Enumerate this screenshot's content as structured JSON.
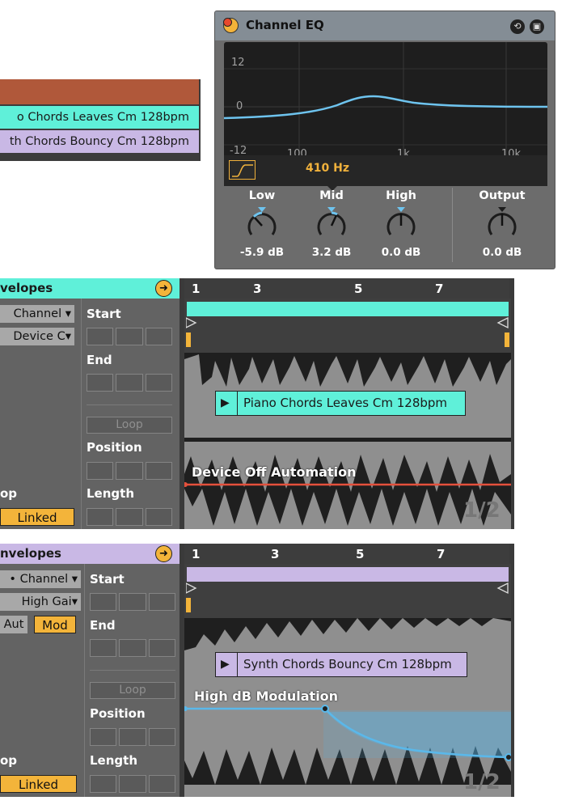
{
  "clip_list": {
    "items": [
      {
        "label": "o Chords Leaves Cm 128bpm",
        "color": "#5ff0d9"
      },
      {
        "label": "th Chords Bouncy Cm 128bpm",
        "color": "#c9b8e5"
      }
    ]
  },
  "eq_device": {
    "title": "Channel EQ",
    "db_ticks": [
      "12",
      "0",
      "-12"
    ],
    "freq_ticks": [
      "100",
      "1k",
      "10k"
    ],
    "frequency": "410 Hz",
    "knobs": [
      {
        "label": "Low",
        "value": "-5.9 dB"
      },
      {
        "label": "Mid",
        "value": "3.2 dB"
      },
      {
        "label": "High",
        "value": "0.0 dB"
      },
      {
        "label": "Output",
        "value": "0.0 dB"
      }
    ],
    "icons": [
      "fold-icon",
      "hot-swap-icon",
      "save-preset-icon",
      "filter-shape-icon"
    ]
  },
  "panels": [
    {
      "title": "velopes",
      "color": "#5ff0d9",
      "dropdown1": "Channel ▾",
      "dropdown2": "Device C▾",
      "start_label": "Start",
      "end_label": "End",
      "loop_button": "Loop",
      "position_label": "Position",
      "length_label": "Length",
      "loop_word": "op",
      "linked": "Linked",
      "ruler": [
        "1",
        "3",
        "5",
        "7"
      ],
      "clip_name": "Piano Chords Leaves Cm 128bpm",
      "automation_label": "Device Off Automation",
      "page": "1/2",
      "automation_color": "#e4503c"
    },
    {
      "title": "nvelopes",
      "color": "#c9b8e5",
      "dropdown1": "• Channel ▾",
      "dropdown2": "High Gai▾",
      "aut_label": "Aut",
      "mod_label": "Mod",
      "start_label": "Start",
      "end_label": "End",
      "loop_button": "Loop",
      "position_label": "Position",
      "length_label": "Length",
      "loop_word": "op",
      "linked": "Linked",
      "ruler": [
        "1",
        "3",
        "5",
        "7"
      ],
      "clip_name": "Synth Chords Bouncy Cm 128bpm",
      "automation_label": "High dB Modulation",
      "page": "1/2",
      "modulation_color": "#5ab8ea"
    }
  ]
}
